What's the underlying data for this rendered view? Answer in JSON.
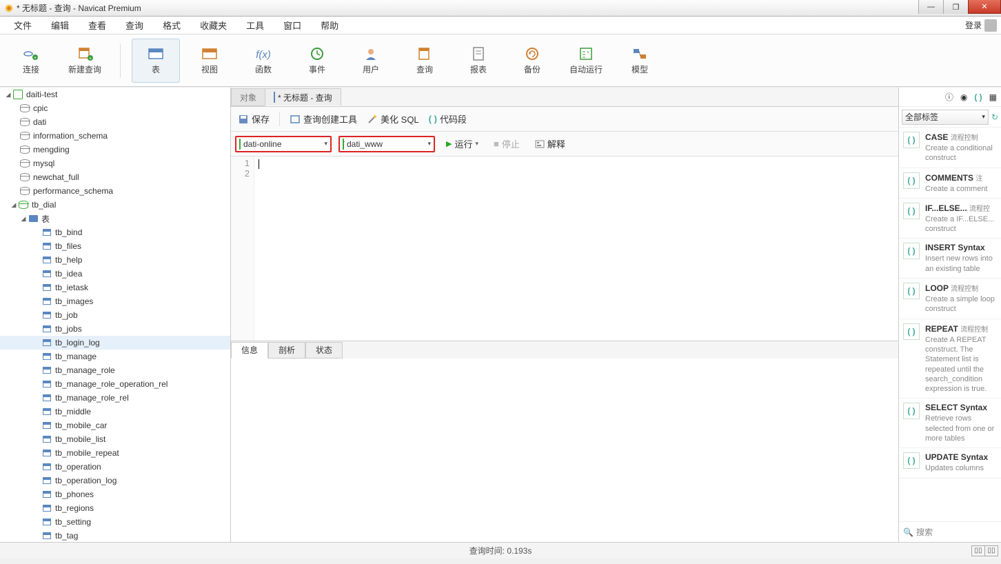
{
  "window": {
    "title": "* 无标题 - 查询 - Navicat Premium"
  },
  "menubar": {
    "items": [
      "文件",
      "编辑",
      "查看",
      "查询",
      "格式",
      "收藏夹",
      "工具",
      "窗口",
      "帮助"
    ],
    "login": "登录"
  },
  "toolbar": {
    "items": [
      {
        "label": "连接",
        "key": "connect"
      },
      {
        "label": "新建查询",
        "key": "new-query"
      },
      {
        "label": "表",
        "key": "table",
        "active": true
      },
      {
        "label": "视图",
        "key": "view"
      },
      {
        "label": "函数",
        "key": "function"
      },
      {
        "label": "事件",
        "key": "event"
      },
      {
        "label": "用户",
        "key": "user"
      },
      {
        "label": "查询",
        "key": "query"
      },
      {
        "label": "报表",
        "key": "report"
      },
      {
        "label": "备份",
        "key": "backup"
      },
      {
        "label": "自动运行",
        "key": "autorun"
      },
      {
        "label": "模型",
        "key": "model"
      }
    ]
  },
  "tree": {
    "root": {
      "label": "daiti-test"
    },
    "dbs": [
      "cpic",
      "dati",
      "information_schema",
      "mengding",
      "mysql",
      "newchat_full",
      "performance_schema"
    ],
    "active_db": "tb_dial",
    "folder": "表",
    "tables": [
      "tb_bind",
      "tb_files",
      "tb_help",
      "tb_idea",
      "tb_ietask",
      "tb_images",
      "tb_job",
      "tb_jobs",
      "tb_login_log",
      "tb_manage",
      "tb_manage_role",
      "tb_manage_role_operation_rel",
      "tb_manage_role_rel",
      "tb_middle",
      "tb_mobile_car",
      "tb_mobile_list",
      "tb_mobile_repeat",
      "tb_operation",
      "tb_operation_log",
      "tb_phones",
      "tb_regions",
      "tb_setting",
      "tb_tag"
    ],
    "selected_table": "tb_login_log"
  },
  "center": {
    "tabs": {
      "object": "对象",
      "query": "* 无标题 - 查询"
    },
    "querybar": {
      "save": "保存",
      "builder": "查询创建工具",
      "beautify": "美化 SQL",
      "snippet": "代码段"
    },
    "conn": {
      "connection": "dati-online",
      "database": "dati_www",
      "run": "运行",
      "stop": "停止",
      "explain": "解释"
    },
    "editor": {
      "lines": [
        "1",
        "2"
      ]
    },
    "bottom_tabs": {
      "info": "信息",
      "profile": "剖析",
      "status": "状态"
    }
  },
  "rightpane": {
    "filter": "全部标签",
    "snippets": [
      {
        "title": "CASE",
        "tag": "流程控制",
        "desc": "Create a conditional construct"
      },
      {
        "title": "COMMENTS",
        "tag": "注",
        "desc": "Create a comment"
      },
      {
        "title": "IF...ELSE...",
        "tag": "流程控",
        "desc": "Create a IF...ELSE... construct"
      },
      {
        "title": "INSERT Syntax",
        "tag": "",
        "desc": "Insert new rows into an existing table"
      },
      {
        "title": "LOOP",
        "tag": "流程控制",
        "desc": "Create a simple loop construct"
      },
      {
        "title": "REPEAT",
        "tag": "流程控制",
        "desc": "Create A REPEAT construct. The Statement list is repeated until the search_condition expression is true."
      },
      {
        "title": "SELECT Syntax",
        "tag": "",
        "desc": "Retrieve rows selected from one or more tables"
      },
      {
        "title": "UPDATE Syntax",
        "tag": "",
        "desc": "Updates columns"
      }
    ],
    "search_placeholder": "搜索"
  },
  "statusbar": {
    "query_time": "查询时间: 0.193s"
  }
}
